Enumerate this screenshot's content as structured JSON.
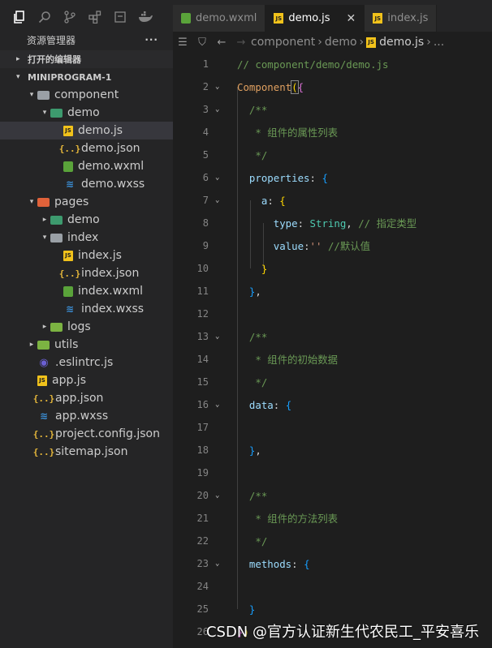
{
  "explorer": {
    "title": "资源管理器",
    "more": "···",
    "open_editors": "打开的编辑器",
    "project": "MINIPROGRAM-1"
  },
  "tree": [
    {
      "label": "component",
      "depth": 1,
      "kind": "folder-open",
      "arrow": "▾"
    },
    {
      "label": "demo",
      "depth": 2,
      "kind": "folder-green",
      "arrow": "▾"
    },
    {
      "label": "demo.js",
      "depth": 3,
      "kind": "js",
      "selected": true
    },
    {
      "label": "demo.json",
      "depth": 3,
      "kind": "json"
    },
    {
      "label": "demo.wxml",
      "depth": 3,
      "kind": "wxml"
    },
    {
      "label": "demo.wxss",
      "depth": 3,
      "kind": "wxss"
    },
    {
      "label": "pages",
      "depth": 1,
      "kind": "folder-red",
      "arrow": "▾"
    },
    {
      "label": "demo",
      "depth": 2,
      "kind": "folder-green",
      "arrow": "▸"
    },
    {
      "label": "index",
      "depth": 2,
      "kind": "folder-open",
      "arrow": "▾"
    },
    {
      "label": "index.js",
      "depth": 3,
      "kind": "js"
    },
    {
      "label": "index.json",
      "depth": 3,
      "kind": "json"
    },
    {
      "label": "index.wxml",
      "depth": 3,
      "kind": "wxml"
    },
    {
      "label": "index.wxss",
      "depth": 3,
      "kind": "wxss"
    },
    {
      "label": "logs",
      "depth": 2,
      "kind": "folder-lime",
      "arrow": "▸"
    },
    {
      "label": "utils",
      "depth": 1,
      "kind": "folder-lime",
      "arrow": "▸"
    },
    {
      "label": ".eslintrc.js",
      "depth": 1,
      "kind": "eslint"
    },
    {
      "label": "app.js",
      "depth": 1,
      "kind": "js"
    },
    {
      "label": "app.json",
      "depth": 1,
      "kind": "json"
    },
    {
      "label": "app.wxss",
      "depth": 1,
      "kind": "wxss"
    },
    {
      "label": "project.config.json",
      "depth": 1,
      "kind": "json"
    },
    {
      "label": "sitemap.json",
      "depth": 1,
      "kind": "json"
    }
  ],
  "tabs": [
    {
      "label": "demo.wxml",
      "icon": "wxml-file-icon",
      "active": false
    },
    {
      "label": "demo.js",
      "icon": "js-file-icon",
      "active": true,
      "close": "✕"
    },
    {
      "label": "index.js",
      "icon": "js-file-icon",
      "active": false
    }
  ],
  "breadcrumb": {
    "items": [
      "component",
      "demo",
      "demo.js"
    ],
    "tail": "..."
  },
  "code_lines": [
    {
      "n": "1",
      "html": "<span class=\"c\">// component/demo/demo.js</span>"
    },
    {
      "n": "2",
      "html": "<span class=\"fnc\">Component</span><span class=\"b1 bhl\">(</span><span class=\"b2\">{</span>",
      "fold": true
    },
    {
      "n": "3",
      "html": "  <span class=\"c\">/**</span>",
      "fold": true
    },
    {
      "n": "4",
      "html": "   <span class=\"c\">* 组件的属性列表</span>"
    },
    {
      "n": "5",
      "html": "   <span class=\"c\">*/</span>"
    },
    {
      "n": "6",
      "html": "  <span class=\"p\">properties</span>: <span class=\"b3\">{</span>",
      "fold": true
    },
    {
      "n": "7",
      "html": "    <span class=\"p\">a</span>: <span class=\"b1\">{</span>",
      "fold": true
    },
    {
      "n": "8",
      "html": "      <span class=\"p\">type</span>: <span class=\"t\">String</span>, <span class=\"c\">// 指定类型</span>"
    },
    {
      "n": "9",
      "html": "      <span class=\"p\">value</span>:<span class=\"s\">''</span> <span class=\"c\">//默认值</span>"
    },
    {
      "n": "10",
      "html": "    <span class=\"b1\">}</span>"
    },
    {
      "n": "11",
      "html": "  <span class=\"b3\">}</span>,"
    },
    {
      "n": "12",
      "html": ""
    },
    {
      "n": "13",
      "html": "  <span class=\"c\">/**</span>",
      "fold": true
    },
    {
      "n": "14",
      "html": "   <span class=\"c\">* 组件的初始数据</span>"
    },
    {
      "n": "15",
      "html": "   <span class=\"c\">*/</span>"
    },
    {
      "n": "16",
      "html": "  <span class=\"p\">data</span>: <span class=\"b3\">{</span>",
      "fold": true
    },
    {
      "n": "17",
      "html": ""
    },
    {
      "n": "18",
      "html": "  <span class=\"b3\">}</span>,"
    },
    {
      "n": "19",
      "html": ""
    },
    {
      "n": "20",
      "html": "  <span class=\"c\">/**</span>",
      "fold": true
    },
    {
      "n": "21",
      "html": "   <span class=\"c\">* 组件的方法列表</span>"
    },
    {
      "n": "22",
      "html": "   <span class=\"c\">*/</span>"
    },
    {
      "n": "23",
      "html": "  <span class=\"p\">methods</span>: <span class=\"b3\">{</span>",
      "fold": true
    },
    {
      "n": "24",
      "html": ""
    },
    {
      "n": "25",
      "html": "  <span class=\"b3\">}</span>"
    },
    {
      "n": "26",
      "html": "<span class=\"b2\">}</span><span class=\"b1\">)</span>"
    }
  ],
  "watermark": "CSDN @官方认证新生代农民工_平安喜乐",
  "activity_icons": [
    "files-icon",
    "search-icon",
    "source-control-icon",
    "extensions-icon",
    "outline-icon",
    "docker-icon"
  ]
}
